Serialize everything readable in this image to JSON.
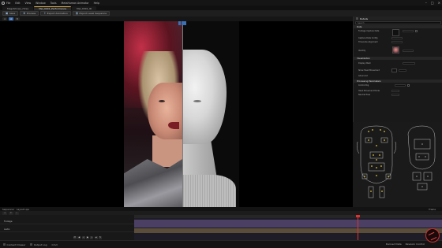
{
  "menu": [
    "File",
    "Edit",
    "View",
    "Window",
    "Tools",
    "MetaHuman Animator",
    "Help"
  ],
  "tabs": [
    "MegaShowy_Hires",
    "Mel_0001_Performance",
    "Mel_0001_ID"
  ],
  "active_tab_index": 1,
  "toolbar": {
    "save_label": "Save",
    "process_label": "Process",
    "export_animation_label": "Export Animation",
    "export_level_sequence_label": "Export Level Sequence"
  },
  "viewport": {
    "mode_label": "A",
    "view_label": "B",
    "lit_label": "Lit"
  },
  "details": {
    "title": "Details",
    "search_placeholder": "Search",
    "sections": {
      "data": "Data",
      "visualization": "Visualization",
      "processing": "Processing Parameters"
    },
    "rows": {
      "footage_capture_data": "Footage Capture Data",
      "capture_data_config": "Capture Data Config",
      "timecode_alignment": "Timecode Alignment",
      "identity": "Identity",
      "display_mesh": "Display Mesh",
      "show_headmovement": "Show Head Movement",
      "advanced": "Advanced",
      "control_rig": "Control Rig",
      "head_movement_mode": "Head Movement Mode",
      "neutral_pose": "Neutral Pose"
    }
  },
  "timeline": {
    "tabs": [
      "Sequencer",
      "Layout Lips"
    ],
    "tracks": [
      "Footage",
      "Audio"
    ],
    "frame_label": "Frame"
  },
  "statusbar": {
    "content_drawer": "Content Drawer",
    "output_log": "Output Log",
    "cmd": "Cmd",
    "derived_data": "Derived Data",
    "source_control": "Revision Control"
  },
  "accent_color": "#3b6fb3",
  "playhead_color": "#dd3333"
}
